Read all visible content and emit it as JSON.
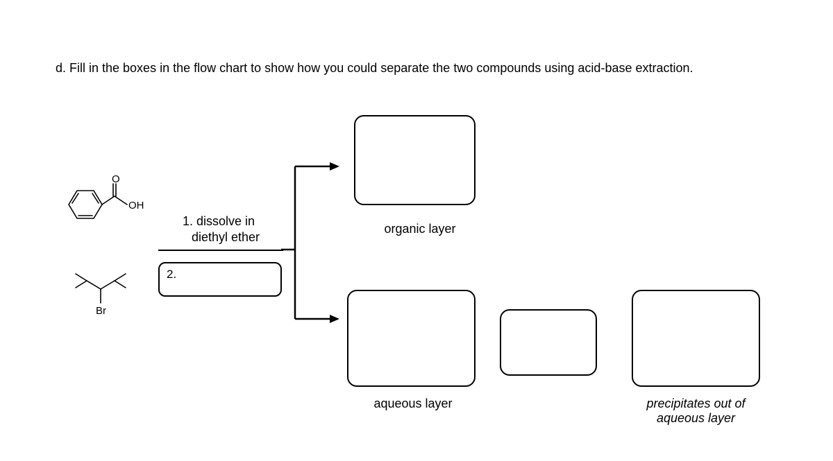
{
  "question": "d. Fill in the boxes in the flow chart to show how you could separate the two compounds using acid-base extraction.",
  "structures": {
    "top": {
      "label_oh": "OH",
      "label_o": "O"
    },
    "bottom": {
      "label_br": "Br"
    }
  },
  "steps": {
    "step1": "1. dissolve in\n    diethyl ether",
    "step2_prefix": "2."
  },
  "labels": {
    "organic_layer": "organic layer",
    "aqueous_layer": "aqueous layer",
    "precipitates": "precipitates out of\naqueous layer"
  }
}
